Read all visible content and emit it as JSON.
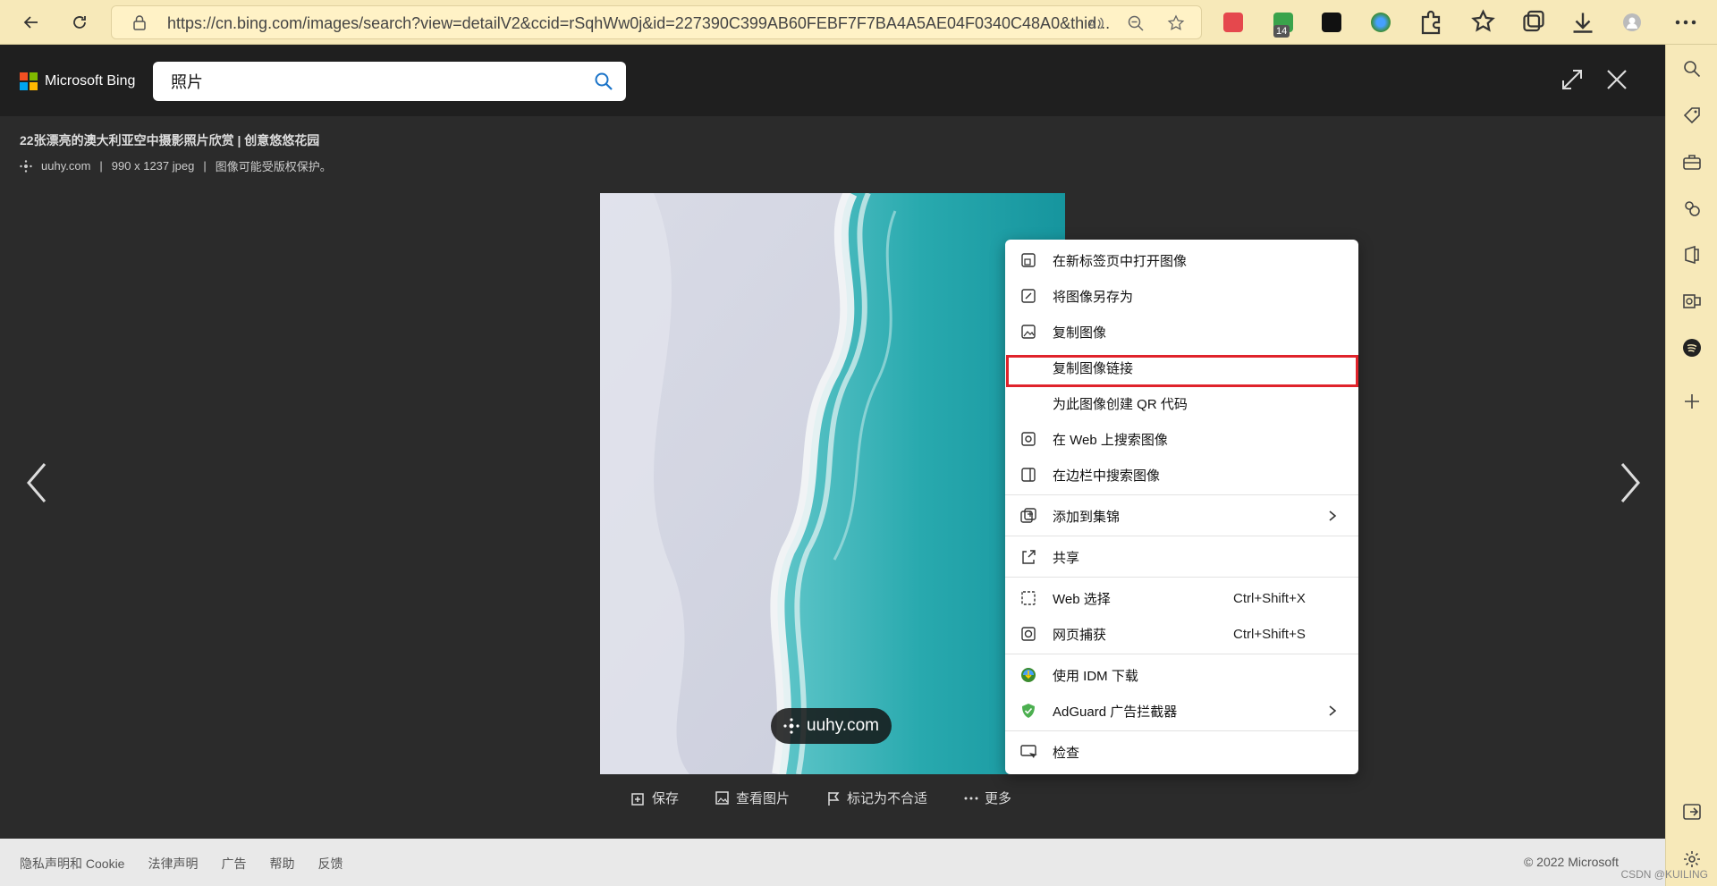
{
  "browser": {
    "url": "https://cn.bing.com/images/search?view=detailV2&ccid=rSqhWw0j&id=227390C399AB60FEBF7F7BA4A5AE04F0340C48A0&thid...",
    "extension_badge": "14"
  },
  "bing": {
    "brand": "Microsoft Bing",
    "search_value": "照片"
  },
  "image_info": {
    "title": "22张漂亮的澳大利亚空中摄影照片欣赏 | 创意悠悠花园",
    "source": "uuhy.com",
    "size": "990 x 1237 jpeg",
    "copyright": "图像可能受版权保护。",
    "separator": "|"
  },
  "watermark": "uuhy.com",
  "actions": [
    {
      "label": "保存"
    },
    {
      "label": "查看图片"
    },
    {
      "label": "标记为不合适"
    },
    {
      "label": "更多"
    }
  ],
  "footer": {
    "links": [
      "隐私声明和 Cookie",
      "法律声明",
      "广告",
      "帮助",
      "反馈"
    ],
    "copyright": "© 2022 Microsoft",
    "csdn": "CSDN @KUILING"
  },
  "menu": {
    "items": [
      {
        "label": "在新标签页中打开图像",
        "shortcut": ""
      },
      {
        "label": "将图像另存为",
        "shortcut": ""
      },
      {
        "label": "复制图像",
        "shortcut": ""
      },
      {
        "label": "复制图像链接",
        "shortcut": ""
      },
      {
        "label": "为此图像创建 QR 代码",
        "shortcut": ""
      },
      {
        "label": "在 Web 上搜索图像",
        "shortcut": ""
      },
      {
        "label": "在边栏中搜索图像",
        "shortcut": ""
      },
      {
        "label": "添加到集锦",
        "shortcut": ""
      },
      {
        "label": "共享",
        "shortcut": ""
      },
      {
        "label": "Web 选择",
        "shortcut": "Ctrl+Shift+X"
      },
      {
        "label": "网页捕获",
        "shortcut": "Ctrl+Shift+S"
      },
      {
        "label": "使用 IDM 下载",
        "shortcut": ""
      },
      {
        "label": "AdGuard 广告拦截器",
        "shortcut": ""
      },
      {
        "label": "检查",
        "shortcut": ""
      }
    ],
    "highlighted_item": "复制图像链接",
    "highlight_color": "#e0232b"
  },
  "colors": {
    "toolbar_bg": "#f7e9b9",
    "page_bg": "#2b2b2b",
    "header_bg": "#1f1f1f",
    "accent": "#1a73c8"
  }
}
